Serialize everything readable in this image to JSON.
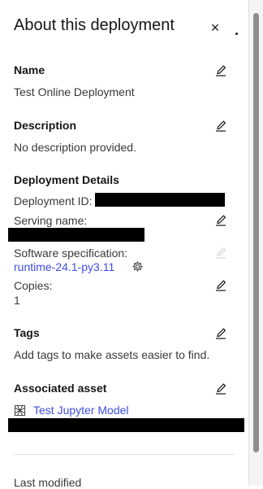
{
  "panel": {
    "title": "About this deployment",
    "close_label": "×"
  },
  "name_section": {
    "label": "Name",
    "value": "Test Online Deployment"
  },
  "description_section": {
    "label": "Description",
    "value": "No description provided."
  },
  "details_section": {
    "label": "Deployment Details",
    "deployment_id_label": "Deployment ID:",
    "serving_name_label": "Serving name:",
    "software_spec_label": "Software specification:",
    "software_spec_value": "runtime-24.1-py3.11",
    "copies_label": "Copies:",
    "copies_value": "1"
  },
  "tags_section": {
    "label": "Tags",
    "value": "Add tags to make assets easier to find."
  },
  "asset_section": {
    "label": "Associated asset",
    "asset_name": "Test Jupyter Model"
  },
  "footer": {
    "last_modified_label": "Last modified"
  },
  "colors": {
    "link": "#3d4ee5",
    "redaction": "#000000",
    "text": "#161616"
  },
  "icons": [
    "close-icon",
    "edit-icon",
    "gear-icon",
    "model-icon"
  ]
}
